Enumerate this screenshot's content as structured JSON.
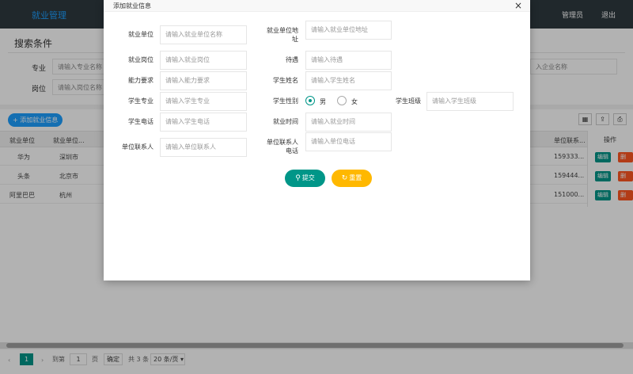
{
  "header": {
    "brand": "就业管理",
    "user": "管理员",
    "logout": "退出"
  },
  "search": {
    "title": "搜索条件",
    "major_label": "专业",
    "major_placeholder": "请输入专业名称",
    "position_label": "岗位",
    "position_placeholder": "请输入岗位名称",
    "company_placeholder": "入企业名称"
  },
  "list": {
    "add_label": "添加就业信息",
    "columns": [
      "就业单位",
      "就业单位...",
      "单位联系...",
      "操作"
    ],
    "rows": [
      {
        "company": "华为",
        "city": "深圳市",
        "phone": "159333..."
      },
      {
        "company": "头条",
        "city": "北京市",
        "phone": "159444..."
      },
      {
        "company": "阿里巴巴",
        "city": "杭州",
        "phone": "151000..."
      }
    ],
    "edit_label": "编辑",
    "delete_label": "删除"
  },
  "pager": {
    "current": "1",
    "goto_label": "到第",
    "page_input": "1",
    "page_unit": "页",
    "confirm": "确定",
    "total": "共 3 条",
    "per_page": "20 条/页"
  },
  "dialog": {
    "title": "添加就业信息",
    "fields": {
      "company_label": "就业单位",
      "company_ph": "请输入就业单位名称",
      "address_label": "就业单位地址",
      "address_ph": "请输入就业单位地址",
      "post_label": "就业岗位",
      "post_ph": "请输入就业岗位",
      "salary_label": "待遇",
      "salary_ph": "请输入待遇",
      "ability_label": "能力要求",
      "ability_ph": "请输入能力要求",
      "student_name_label": "学生姓名",
      "student_name_ph": "请输入学生姓名",
      "major_label": "学生专业",
      "major_ph": "请输入学生专业",
      "gender_label": "学生性别",
      "male": "男",
      "female": "女",
      "class_label": "学生班级",
      "class_ph": "请输入学生班级",
      "phone_label": "学生电话",
      "phone_ph": "请输入学生电话",
      "time_label": "就业时间",
      "time_ph": "请输入就业时间",
      "contact_label": "单位联系人",
      "contact_ph": "请输入单位联系人",
      "contact_phone_label": "单位联系人电话",
      "contact_phone_ph": "请输入单位电话"
    },
    "submit": "提交",
    "reset": "重置"
  },
  "colors": {
    "teal": "#009688",
    "orange": "#ffb800",
    "blue": "#1e9fff",
    "red": "#ff5722"
  }
}
